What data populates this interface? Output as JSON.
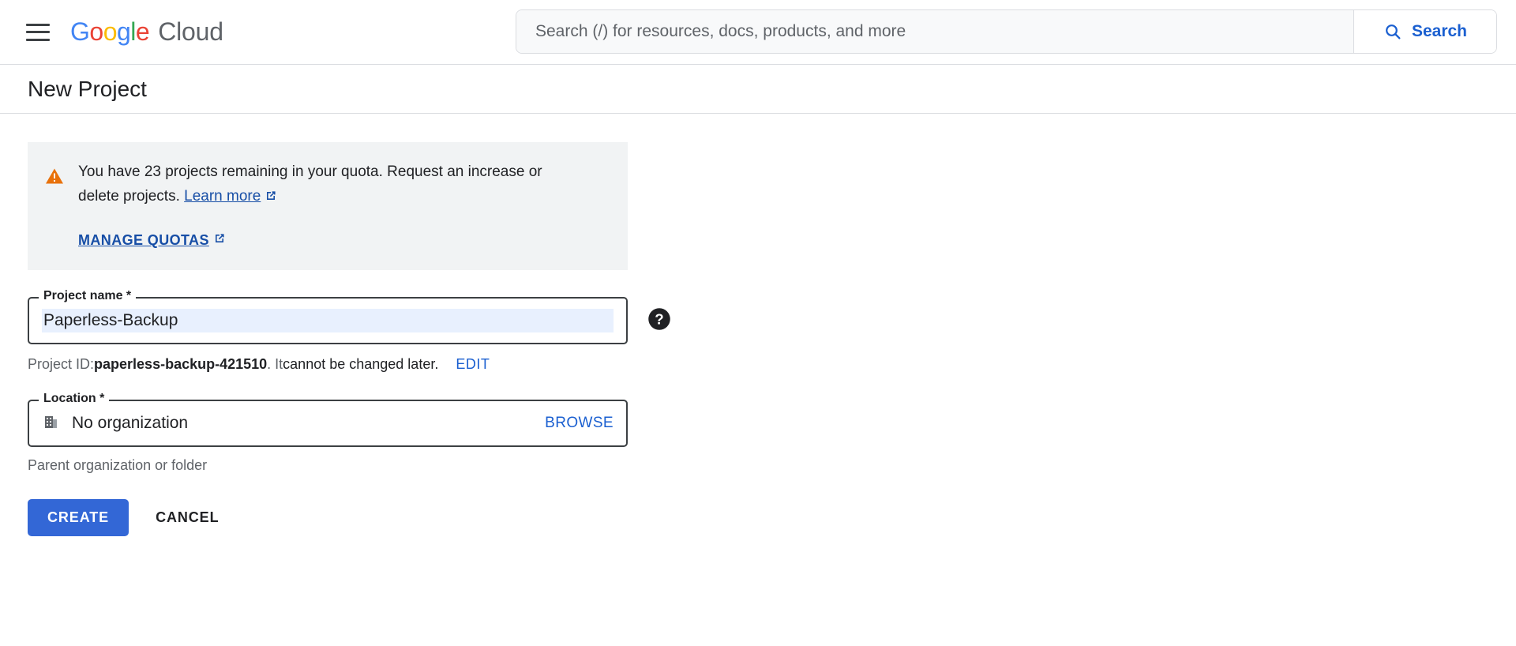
{
  "header": {
    "menu_icon": "hamburger-menu-icon",
    "brand": {
      "google": [
        "G",
        "o",
        "o",
        "g",
        "l",
        "e"
      ],
      "product": "Cloud"
    },
    "search": {
      "placeholder": "Search (/) for resources, docs, products, and more",
      "value": "",
      "button_label": "Search",
      "button_icon": "search-icon"
    }
  },
  "page": {
    "title": "New Project"
  },
  "banner": {
    "icon": "warning-triangle-icon",
    "icon_color": "#e8710a",
    "text_before_link": "You have 23 projects remaining in your quota. Request an increase or delete projects. ",
    "learn_more_label": "Learn more",
    "learn_more_icon": "external-link-icon",
    "manage_quotas_label": "MANAGE QUOTAS",
    "manage_quotas_icon": "external-link-icon",
    "background": "#f1f3f4"
  },
  "project_name_field": {
    "label": "Project name *",
    "value": "Paperless-Backup",
    "help_icon": "help-circle-icon",
    "highlight_color": "#e8f0fe"
  },
  "project_id_hint": {
    "prefix": "Project ID: ",
    "id": "paperless-backup-421510",
    "middle": ". It ",
    "emphasis": "cannot be changed later.",
    "edit_label": "EDIT"
  },
  "location_field": {
    "label": "Location *",
    "icon": "organization-building-icon",
    "value": "No organization",
    "browse_label": "BROWSE",
    "helper_text": "Parent organization or folder"
  },
  "actions": {
    "create_label": "CREATE",
    "cancel_label": "CANCEL",
    "create_color": "#3367d6"
  }
}
